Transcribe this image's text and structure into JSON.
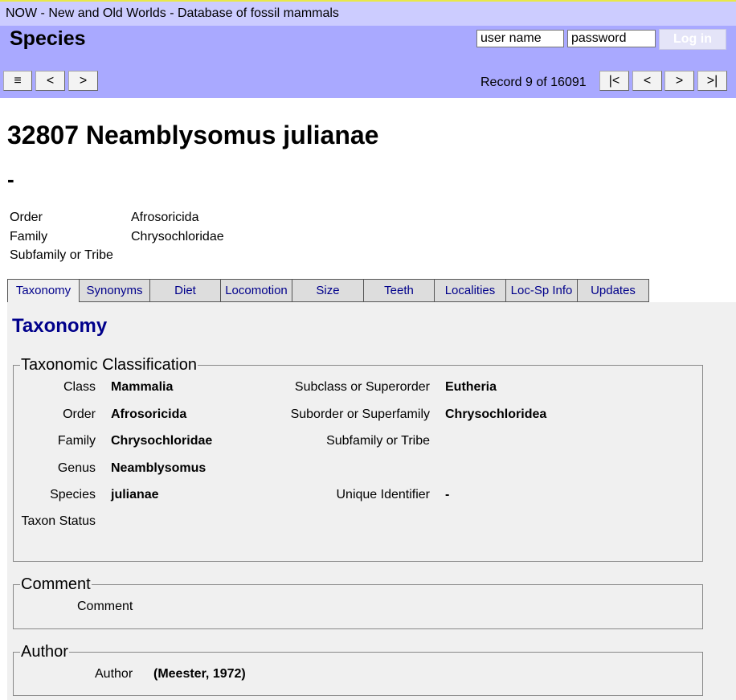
{
  "app_title": "NOW - New and Old Worlds - Database of fossil mammals",
  "header": {
    "page_heading": "Species",
    "username_placeholder": "user name",
    "password_placeholder": "password",
    "login_label": "Log in",
    "menu_label": "≡",
    "back_label": "<",
    "forward_label": ">",
    "record_text": "Record 9 of 16091",
    "first_label": "|<",
    "prev_label": "<",
    "next_label": ">",
    "last_label": ">|"
  },
  "species": {
    "title": "32807 Neamblysomus julianae",
    "subtitle": "-",
    "summary": [
      {
        "label": "Order",
        "value": "Afrosoricida"
      },
      {
        "label": "Family",
        "value": "Chrysochloridae"
      },
      {
        "label": "Subfamily or Tribe",
        "value": ""
      }
    ]
  },
  "tabs": [
    "Taxonomy",
    "Synonyms",
    "Diet",
    "Locomotion",
    "Size",
    "Teeth",
    "Localities",
    "Loc-Sp Info",
    "Updates"
  ],
  "active_tab": "Taxonomy",
  "taxonomy": {
    "heading": "Taxonomy",
    "classification_legend": "Taxonomic Classification",
    "left": [
      {
        "label": "Class",
        "value": "Mammalia"
      },
      {
        "label": "Order",
        "value": "Afrosoricida"
      },
      {
        "label": "Family",
        "value": "Chrysochloridae"
      },
      {
        "label": "Genus",
        "value": "Neamblysomus"
      },
      {
        "label": "Species",
        "value": "julianae"
      },
      {
        "label": "Taxon Status",
        "value": ""
      }
    ],
    "right": [
      {
        "label": "Subclass or Superorder",
        "value": "Eutheria"
      },
      {
        "label": "Suborder or Superfamily",
        "value": "Chrysochloridea"
      },
      {
        "label": "Subfamily or Tribe",
        "value": ""
      },
      {
        "label": "Unique Identifier",
        "value": "-"
      }
    ],
    "comment_legend": "Comment",
    "comment_label": "Comment",
    "comment_value": "",
    "author_legend": "Author",
    "author_label": "Author",
    "author_value": "(Meester, 1972)"
  }
}
